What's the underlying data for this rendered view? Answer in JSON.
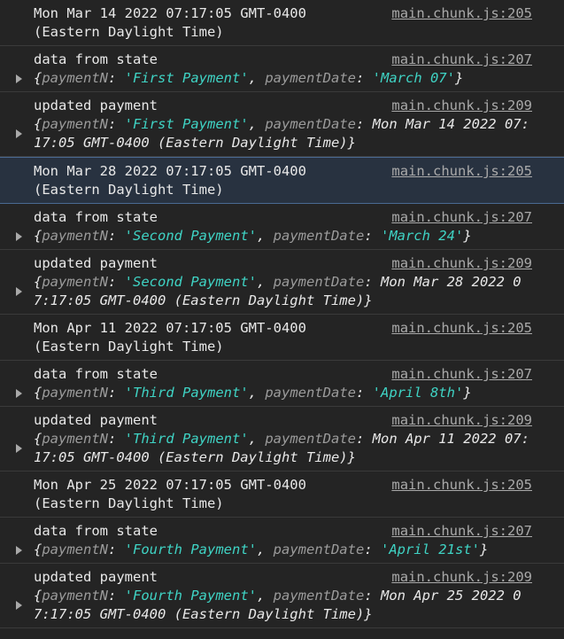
{
  "entries": [
    {
      "kind": "date",
      "text": "Mon Mar 14 2022 07:17:05 GMT-0400\n(Eastern Daylight Time)",
      "source": "main.chunk.js:205",
      "selected": false
    },
    {
      "kind": "state",
      "label": "data from state",
      "source": "main.chunk.js:207",
      "paymentN": "'First Payment'",
      "paymentDate": "'March 07'"
    },
    {
      "kind": "updated",
      "label": "updated payment",
      "source": "main.chunk.js:209",
      "paymentN": "'First Payment'",
      "paymentDate": "Mon Mar 14 2022 07:17:05 GMT-0400 (Eastern Daylight Time)"
    },
    {
      "kind": "date",
      "text": "Mon Mar 28 2022 07:17:05 GMT-0400\n(Eastern Daylight Time)",
      "source": "main.chunk.js:205",
      "selected": true
    },
    {
      "kind": "state",
      "label": "data from state",
      "source": "main.chunk.js:207",
      "paymentN": "'Second Payment'",
      "paymentDate": "'March 24'"
    },
    {
      "kind": "updated",
      "label": "updated payment",
      "source": "main.chunk.js:209",
      "paymentN": "'Second Payment'",
      "paymentDate": "Mon Mar 28 2022 07:17:05 GMT-0400 (Eastern Daylight Time)"
    },
    {
      "kind": "date",
      "text": "Mon Apr 11 2022 07:17:05 GMT-0400\n(Eastern Daylight Time)",
      "source": "main.chunk.js:205",
      "selected": false
    },
    {
      "kind": "state",
      "label": "data from state",
      "source": "main.chunk.js:207",
      "paymentN": "'Third Payment'",
      "paymentDate": "'April 8th'"
    },
    {
      "kind": "updated",
      "label": "updated payment",
      "source": "main.chunk.js:209",
      "paymentN": "'Third Payment'",
      "paymentDate": "Mon Apr 11 2022 07:17:05 GMT-0400 (Eastern Daylight Time)"
    },
    {
      "kind": "date",
      "text": "Mon Apr 25 2022 07:17:05 GMT-0400\n(Eastern Daylight Time)",
      "source": "main.chunk.js:205",
      "selected": false
    },
    {
      "kind": "state",
      "label": "data from state",
      "source": "main.chunk.js:207",
      "paymentN": "'Fourth Payment'",
      "paymentDate": "'April 21st'"
    },
    {
      "kind": "updated",
      "label": "updated payment",
      "source": "main.chunk.js:209",
      "paymentN": "'Fourth Payment'",
      "paymentDate": "Mon Apr 25 2022 07:17:05 GMT-0400 (Eastern Daylight Time)"
    }
  ],
  "keys": {
    "paymentN": "paymentN",
    "paymentDate": "paymentDate"
  },
  "colors": {
    "background": "#242424",
    "string": "#3fd3c4",
    "key": "#9b9b9b",
    "link": "#a9a9a9",
    "selected": "#283240"
  }
}
